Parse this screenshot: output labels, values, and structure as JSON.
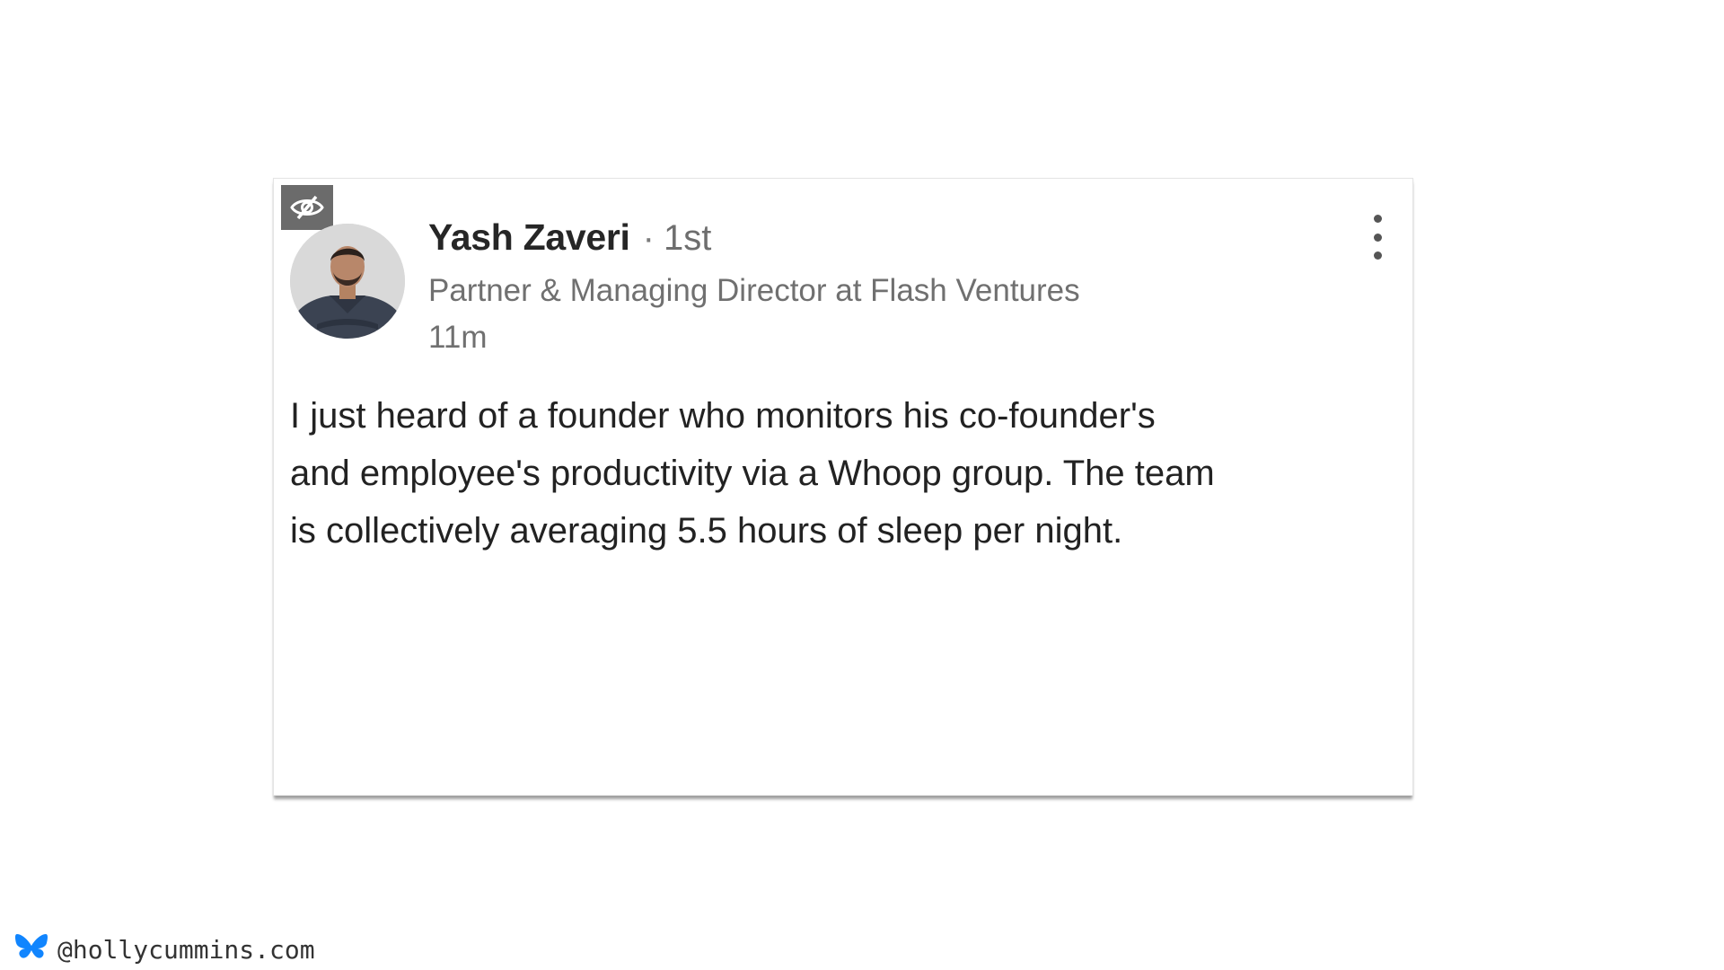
{
  "post": {
    "author_name": "Yash Zaveri",
    "connection_separator": "·",
    "connection_degree": "1st",
    "author_headline": "Partner & Managing Director at Flash Ventures",
    "timestamp": "11m",
    "body_lines": [
      "I just heard of a founder who monitors his co-founder's",
      "and employee's productivity via a Whoop group. The team",
      "is collectively averaging 5.5 hours of sleep per night."
    ],
    "icons": {
      "hide_badge": "eye-slash-icon",
      "more": "more-options-icon"
    }
  },
  "footer": {
    "icon": "bluesky-butterfly-icon",
    "handle": "@hollycummins.com"
  },
  "colors": {
    "bluesky_blue": "#1185fe",
    "badge_gray": "#6b6b6b",
    "text_dark": "#222222",
    "text_muted": "#707070"
  }
}
